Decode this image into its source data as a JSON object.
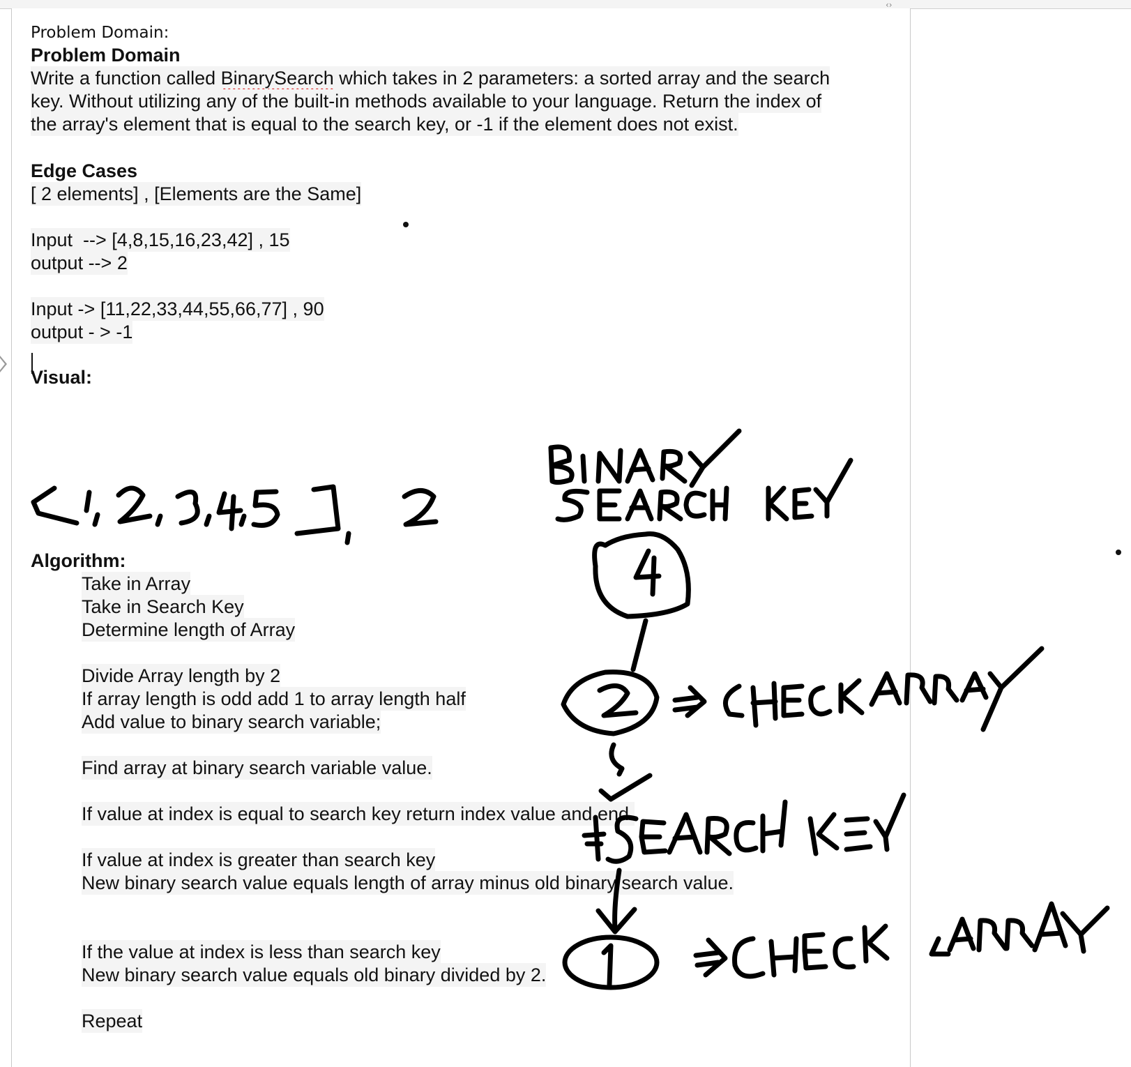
{
  "document": {
    "header_label": "Problem Domain:",
    "problem_heading": "Problem Domain",
    "problem_text": [
      "Write a function called ",
      "BinarySearch",
      " which takes in 2 parameters: a sorted array and the search",
      "key. Without utilizing any of the built-in methods available to your language. Return the index of",
      "the array's element that is equal to the search key, or -1 if the element does not exist."
    ],
    "edge_heading": "Edge Cases",
    "edge_text": "[ 2 elements] , [Elements are the Same]",
    "examples": [
      {
        "input": "Input  --> [4,8,15,16,23,42] , 15",
        "output": "output --> 2"
      },
      {
        "input": "Input -> [11,22,33,44,55,66,77] , 90",
        "output": "output - > -1"
      }
    ],
    "visual_heading": "Visual:",
    "algorithm_heading": "Algorithm:",
    "algorithm_steps": [
      "Take in Array",
      "Take in Search Key",
      "Determine length of Array",
      "Divide Array length by 2",
      "If array length is odd add 1 to array length half",
      "Add value to binary search variable;",
      "Find array at binary search variable value.",
      "If value at index is equal to search key return index value and end.",
      "If value at index is greater than search key",
      "New binary search value equals length of array minus old binary search value.",
      "If the value at index is less than search key",
      "New binary search value equals old binary divided by 2.",
      "Repeat"
    ]
  },
  "handwriting": {
    "array_note": "[1,2,3,4,5], 2",
    "title": "BINARY SEARCH KEY",
    "nodes": [
      "4",
      "2",
      "1"
    ],
    "annotations": [
      "=> CHECK ARRAY",
      "= SEARCH KEY",
      "=> CHECK ARRAY"
    ]
  },
  "icons": {
    "collapse": "chevron-right-icon",
    "corner": "code-brackets-icon"
  }
}
